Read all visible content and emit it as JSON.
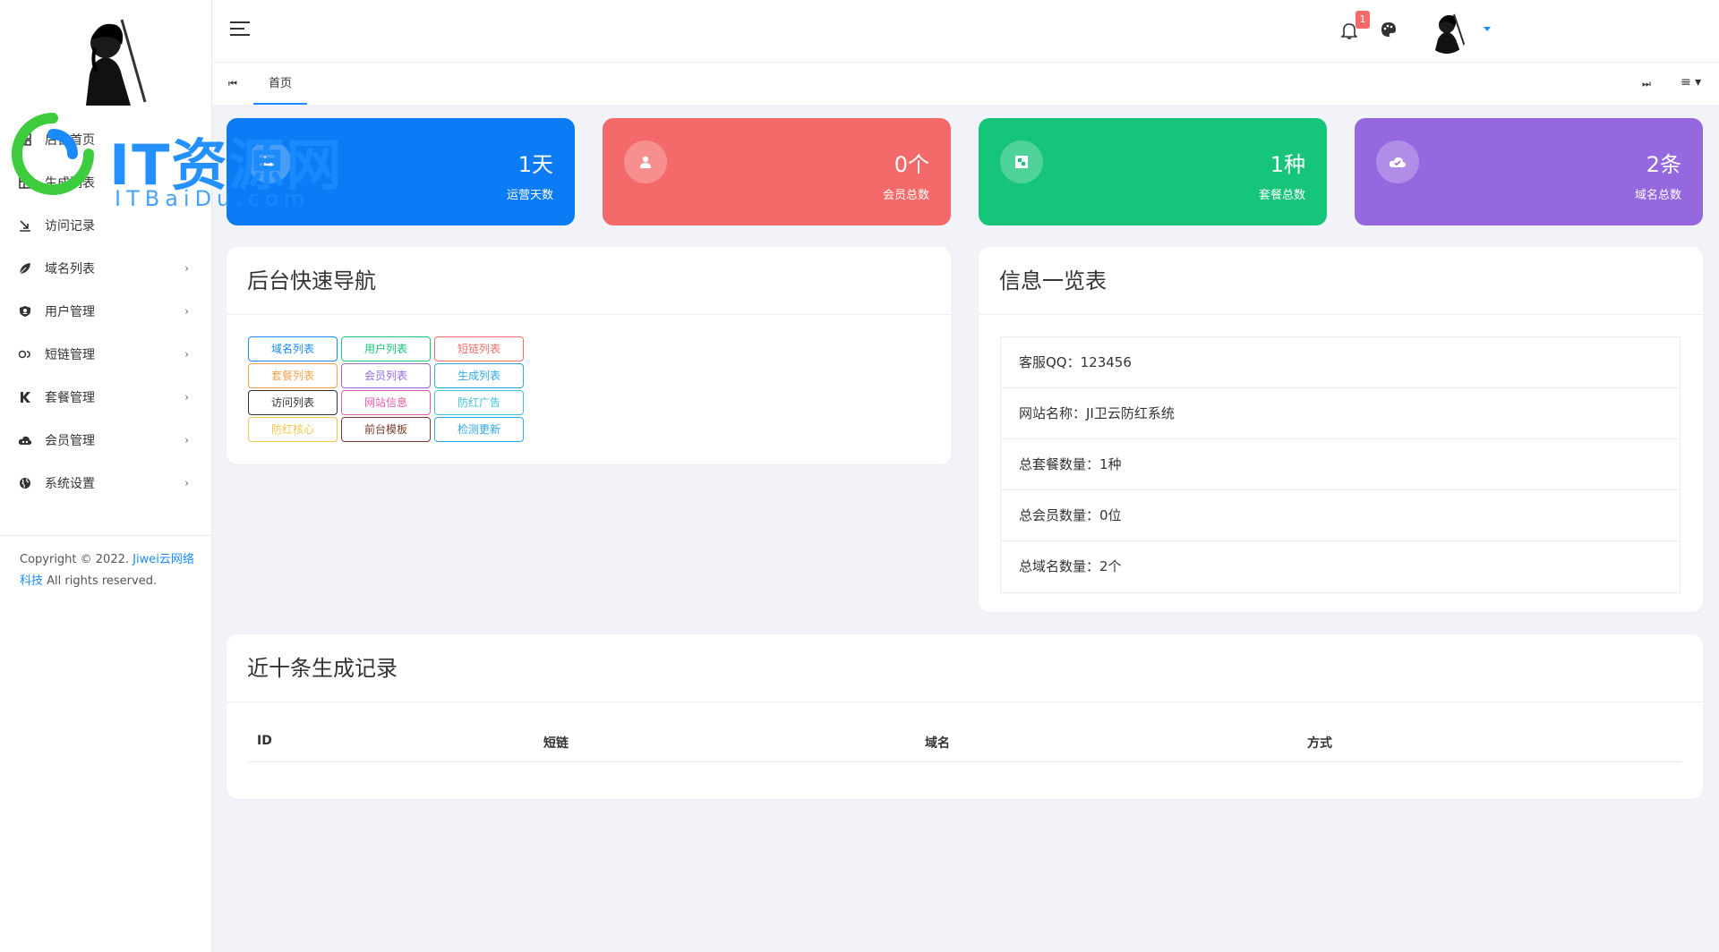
{
  "header": {
    "notification_count": "1"
  },
  "watermark": {
    "title": "IT资源网",
    "subtitle": "ITBaiDu.com"
  },
  "sidebar": {
    "items": [
      {
        "label": "后台首页",
        "icon": "dashboard-icon"
      },
      {
        "label": "生成列表",
        "icon": "table-icon"
      },
      {
        "label": "访问记录",
        "icon": "redirect-icon"
      },
      {
        "label": "域名列表",
        "icon": "leaf-icon",
        "arrow": "›"
      },
      {
        "label": "用户管理",
        "icon": "user-shield-icon",
        "arrow": "›"
      },
      {
        "label": "短链管理",
        "icon": "link-icon",
        "arrow": "›"
      },
      {
        "label": "套餐管理",
        "icon": "k-icon",
        "arrow": "›"
      },
      {
        "label": "会员管理",
        "icon": "cloud-icon",
        "arrow": "›"
      },
      {
        "label": "系统设置",
        "icon": "globe-icon",
        "arrow": "›"
      }
    ],
    "copyright_prefix": "Copyright © 2022.",
    "copyright_link1": "Jiwei云网络",
    "copyright_link2": "科技",
    "copyright_suffix": "All rights reserved."
  },
  "tabs": {
    "home": "首页"
  },
  "stats": [
    {
      "value": "1天",
      "label": "运营天数",
      "color": "#0b7cf5"
    },
    {
      "value": "0个",
      "label": "会员总数",
      "color": "#f46a6a"
    },
    {
      "value": "1种",
      "label": "套餐总数",
      "color": "#16c47a"
    },
    {
      "value": "2条",
      "label": "域名总数",
      "color": "#9668e0"
    }
  ],
  "quick_nav": {
    "title": "后台快速导航",
    "buttons": [
      {
        "label": "域名列表",
        "color": "#1a8bff"
      },
      {
        "label": "用户列表",
        "color": "#16c47a"
      },
      {
        "label": "短链列表",
        "color": "#f46a6a"
      },
      {
        "label": "套餐列表",
        "color": "#f4a14a"
      },
      {
        "label": "会员列表",
        "color": "#9668e0"
      },
      {
        "label": "生成列表",
        "color": "#2fa8e8"
      },
      {
        "label": "访问列表",
        "color": "#333333"
      },
      {
        "label": "网站信息",
        "color": "#e85aa8"
      },
      {
        "label": "防红广告",
        "color": "#3fc1d9"
      },
      {
        "label": "防红核心",
        "color": "#f4c34a"
      },
      {
        "label": "前台模板",
        "color": "#7a3b2e"
      },
      {
        "label": "检测更新",
        "color": "#2fa8e8"
      }
    ]
  },
  "info": {
    "title": "信息一览表",
    "rows": [
      "客服QQ：123456",
      "网站名称：JI卫云防红系统",
      "总套餐数量：1种",
      "总会员数量：0位",
      "总域名数量：2个"
    ]
  },
  "records": {
    "title": "近十条生成记录",
    "columns": [
      "ID",
      "短链",
      "域名",
      "方式"
    ]
  }
}
